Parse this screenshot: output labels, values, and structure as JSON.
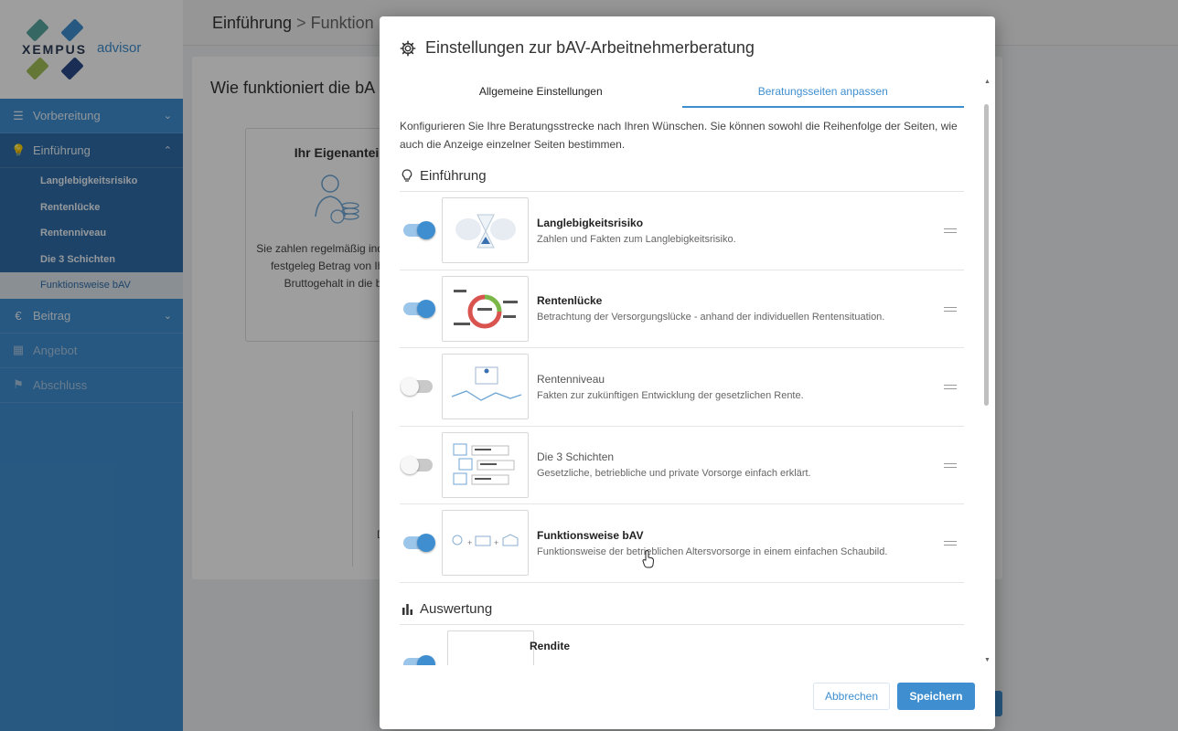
{
  "brand": {
    "wordmark": "XEMPUS",
    "product": "advisor"
  },
  "sidebar": {
    "items": [
      {
        "label": "Vorbereitung",
        "icon": "checklist-icon"
      },
      {
        "label": "Einführung",
        "icon": "lightbulb-icon"
      },
      {
        "label": "Beitrag",
        "icon": "euro-icon"
      },
      {
        "label": "Angebot",
        "icon": "calculator-icon"
      },
      {
        "label": "Abschluss",
        "icon": "flag-icon"
      }
    ],
    "sub_items": [
      "Langlebigkeitsrisiko",
      "Rentenlücke",
      "Rentenniveau",
      "Die 3 Schichten",
      "Funktionsweise bAV"
    ]
  },
  "breadcrumb": {
    "parent": "Einführung",
    "separator": ">",
    "current": "Funktion"
  },
  "background": {
    "card_title": "Wie funktioniert die bA",
    "inner_title": "Ihr Eigenantei",
    "inner_text": "Sie zahlen regelmäßig individuell festgeleg Betrag von Ihrem Bruttogehalt in die bA",
    "fragment": "De"
  },
  "modal": {
    "title": "Einstellungen zur bAV-Arbeitnehmerberatung",
    "tabs": [
      "Allgemeine Einstellungen",
      "Beratungsseiten anpassen"
    ],
    "active_tab": 1,
    "intro": "Konfigurieren Sie Ihre Beratungsstrecke nach Ihren Wünschen. Sie können sowohl die Reihenfolge der Seiten, wie auch die Anzeige einzelner Seiten bestimmen.",
    "sections": [
      {
        "title": "Einführung",
        "icon": "lightbulb-icon",
        "rows": [
          {
            "title": "Langlebigkeitsrisiko",
            "desc": "Zahlen und Fakten zum Langlebigkeitsrisiko.",
            "enabled": true
          },
          {
            "title": "Rentenlücke",
            "desc": "Betrachtung der Versorgungslücke - anhand der individuellen Rentensituation.",
            "enabled": true
          },
          {
            "title": "Rentenniveau",
            "desc": "Fakten zur zukünftigen Entwicklung der gesetzlichen Rente.",
            "enabled": false
          },
          {
            "title": "Die 3 Schichten",
            "desc": "Gesetzliche, betriebliche und private Vorsorge einfach erklärt.",
            "enabled": false
          },
          {
            "title": "Funktionsweise bAV",
            "desc": "Funktionsweise der betrieblichen Altersvorsorge in einem einfachen Schaubild.",
            "enabled": true
          }
        ]
      },
      {
        "title": "Auswertung",
        "icon": "bar-chart-icon",
        "rows": [
          {
            "title": "Rendite",
            "enabled": true
          }
        ]
      }
    ],
    "buttons": {
      "cancel": "Abbrechen",
      "save": "Speichern"
    }
  },
  "colors": {
    "accent": "#3f8fd0",
    "toggle_on_track": "#9cc5ea",
    "toggle_off_track": "#c9c9c9"
  }
}
